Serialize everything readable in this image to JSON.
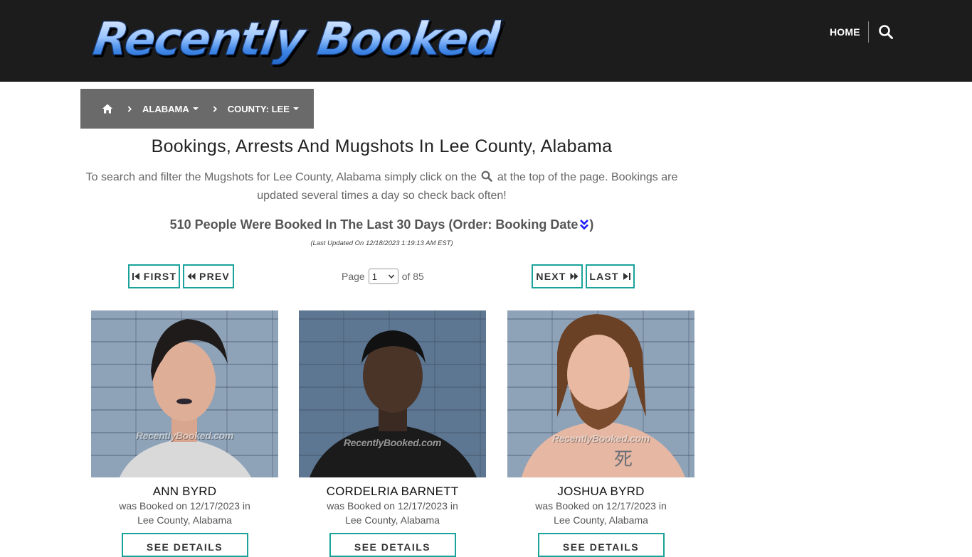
{
  "header": {
    "logo_text": "Recently Booked",
    "nav_home": "HOME"
  },
  "breadcrumb": {
    "state": "ALABAMA",
    "county": "COUNTY: LEE"
  },
  "headline": "Bookings, Arrests And Mugshots In Lee County, Alabama",
  "intro": {
    "before_icon": "To search and filter the Mugshots for Lee County, Alabama simply click on the",
    "after_icon": "at the top of the page. Bookings are updated several times a day so check back often!"
  },
  "count_line": {
    "text": "510 People Were Booked In The Last 30 Days (Order:",
    "order_label": "Booking Date",
    "close": ")"
  },
  "last_updated": "(Last Updated On 12/18/2023 1:19:13 AM EST)",
  "pagination": {
    "first": "FIRST",
    "prev": "PREV",
    "next": "NEXT",
    "last": "LAST",
    "page_label": "Page",
    "current_page": "1",
    "of_label": "of 85"
  },
  "watermark": "RecentlyBooked.com",
  "bookings": [
    {
      "name": "ANN BYRD",
      "booked_line": "was Booked on 12/17/2023 in",
      "location": "Lee County, Alabama",
      "button": "SEE DETAILS"
    },
    {
      "name": "CORDELRIA BARNETT",
      "booked_line": "was Booked on 12/17/2023 in",
      "location": "Lee County, Alabama",
      "button": "SEE DETAILS"
    },
    {
      "name": "JOSHUA BYRD",
      "booked_line": "was Booked on 12/17/2023 in",
      "location": "Lee County, Alabama",
      "button": "SEE DETAILS"
    }
  ],
  "colors": {
    "header_bg": "#1c1c1c",
    "breadcrumb_bg": "#6a6a6a",
    "button_border": "#1aa39a",
    "order_icon": "#1a1aff"
  },
  "icons": {
    "search": "search-icon",
    "home": "home-icon",
    "order": "double-chevron-down-icon"
  }
}
